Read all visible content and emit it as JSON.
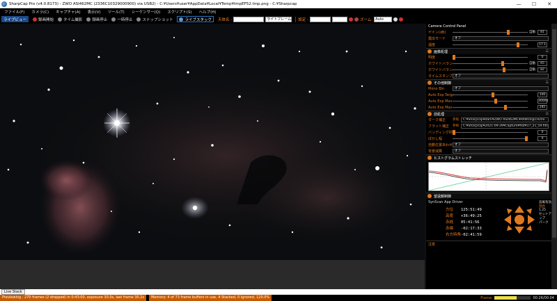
{
  "window": {
    "title": "SharpCap Pro (v4.0.8173) - ZWO ASI462MC (2336C10329000900) via USB2) - C:¥Users¥user¥AppData¥Local¥Temp¥tmpEF52.tmp.png - C:¥Sharpcap",
    "minimize": "—",
    "maximize": "☐",
    "close": "✕"
  },
  "menu": [
    "ファイル(F)",
    "カメラ(C)",
    "キャプチャ(A)",
    "表示(V)",
    "ツール(T)",
    "シーケンサー(Q)",
    "スクリプト(S)",
    "ヘルプ(H)"
  ],
  "toolbar": {
    "live": "ライブビュー",
    "record_start": "録画開始",
    "timelapse": "タイム撮影",
    "record_stop": "録画停止",
    "pause": "一時停止",
    "snapshot": "スナップショット",
    "livestack": "ライブスタック",
    "target_label": "天体名 -",
    "frame_select": "ライトフレーム",
    "profile_label": "設定 -",
    "zoom_label": "ズーム:",
    "zoom_value": "Auto"
  },
  "panel": {
    "title": "Camera Control Panel",
    "top_rows": [
      {
        "label": "ゲイン(dB)",
        "auto": "自動",
        "value": "81"
      },
      {
        "label": "露出モード",
        "dropdown": "オフ"
      },
      {
        "label": "温度",
        "value": "17.1"
      }
    ],
    "image_section": "画像処理",
    "image_rows": [
      {
        "label": "明度",
        "value": "0"
      },
      {
        "label": "ホワイトバランス(赤)",
        "auto": "自動",
        "value": "65"
      },
      {
        "label": "ホワイトバランス(青)",
        "auto": "自動",
        "value": "82"
      },
      {
        "label": "タイムスタンプ",
        "dropdown": "オフ"
      }
    ],
    "misc_section": "その他制御",
    "misc_rows": [
      {
        "label": "Mono Bin",
        "dropdown": "オフ"
      },
      {
        "label": "Auto Exp Target Brightness",
        "value": "100"
      },
      {
        "label": "Auto Exp Max Exp M S",
        "value": "30000"
      },
      {
        "label": "Auto Exp Max Gain",
        "value": "285"
      }
    ],
    "preproc_section": "前処理",
    "preproc_rows": [
      {
        "label": "ダーク補正",
        "browse": "参照",
        "path": "C:¥Sharpcap¥dark¥ZWO ASI462MC¥RAW16@1920x..."
      },
      {
        "label": "フラット補正",
        "browse": "参照",
        "path": "C:¥Sharpcap¥2021-09-29¥Capture¥flat¥17_21_59.fits"
      },
      {
        "label": "バンディング抑制",
        "value": "0"
      },
      {
        "label": "ぼかし幅",
        "value": "0"
      },
      {
        "label": "自動位置あわせ",
        "dropdown": "オフ"
      },
      {
        "label": "背景減算",
        "dropdown": "オフ"
      }
    ],
    "histo_section": "ヒストグラムストレッチ",
    "scope_section": "望遠鏡制御",
    "scope": {
      "driver": "SynScan App Driver",
      "ra_label": "方位",
      "ra": "125:51:49",
      "alt_label": "高度",
      "alt": "+36:49:25",
      "dec_label": "赤経",
      "dec": "05:41:56",
      "lat_label": "赤緯",
      "lat": "-02:17:33",
      "ha_label": "右方時角",
      "ha": "-02:41:59",
      "tracking": "追尾有効",
      "speed_label": "割合",
      "speed_value": "1.25",
      "setup": "セットアップ",
      "park": "パーク"
    },
    "last_row": "注意"
  },
  "tab": "Live Stack",
  "status": {
    "left": "Previewing : 270 frames (2 dropped) in 0:43:00, exposure 30.0s, last frame 30.2s",
    "memory": "Memory: 4 of 73 frame buffers in use, 4 Stacked, 0 Ignored, 120.0%",
    "frames_label": "Frame:",
    "progress": 0.6,
    "time": "00:26/00:04"
  }
}
